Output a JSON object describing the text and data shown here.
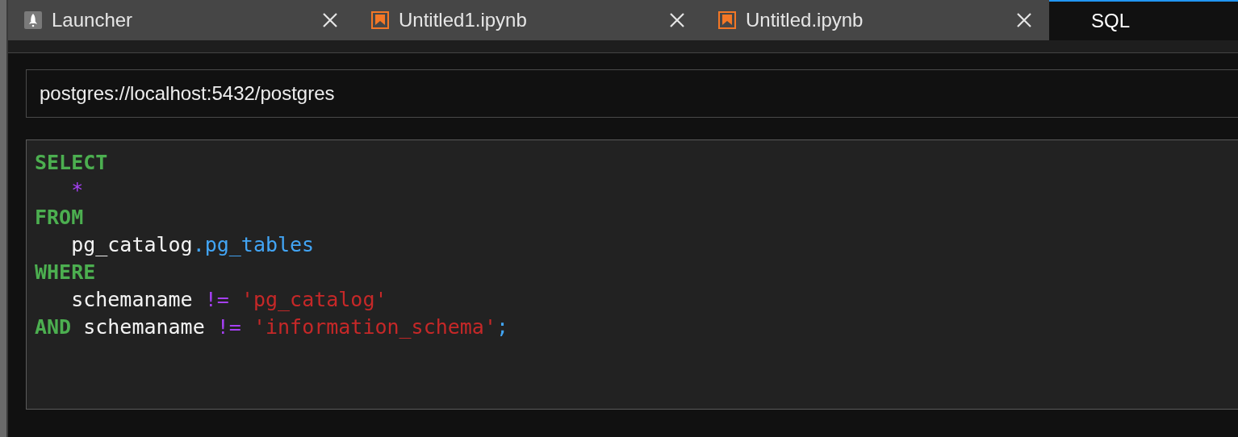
{
  "tabs": [
    {
      "label": "Launcher",
      "kind": "launcher",
      "selected": false,
      "closable": true
    },
    {
      "label": "Untitled1.ipynb",
      "kind": "notebook",
      "selected": false,
      "closable": true
    },
    {
      "label": "Untitled.ipynb",
      "kind": "notebook",
      "selected": false,
      "closable": true
    },
    {
      "label": "SQL",
      "kind": "plain",
      "selected": true,
      "closable": false
    }
  ],
  "connection": {
    "value": "postgres://localhost:5432/postgres"
  },
  "editor": {
    "lines": [
      {
        "indent": false,
        "tokens": [
          {
            "kind": "keyword",
            "text": "SELECT"
          }
        ]
      },
      {
        "indent": true,
        "tokens": [
          {
            "kind": "operator",
            "text": "*"
          }
        ]
      },
      {
        "indent": false,
        "tokens": [
          {
            "kind": "keyword",
            "text": "FROM"
          }
        ]
      },
      {
        "indent": true,
        "tokens": [
          {
            "kind": "plain",
            "text": "pg_catalog"
          },
          {
            "kind": "property",
            "text": ".pg_tables"
          }
        ]
      },
      {
        "indent": false,
        "tokens": [
          {
            "kind": "keyword",
            "text": "WHERE"
          }
        ]
      },
      {
        "indent": true,
        "tokens": [
          {
            "kind": "plain",
            "text": "schemaname "
          },
          {
            "kind": "operator",
            "text": "!= "
          },
          {
            "kind": "string",
            "text": "'pg_catalog'"
          }
        ]
      },
      {
        "indent": false,
        "tokens": [
          {
            "kind": "keyword",
            "text": "AND"
          },
          {
            "kind": "plain",
            "text": " schemaname "
          },
          {
            "kind": "operator",
            "text": "!= "
          },
          {
            "kind": "string",
            "text": "'information_schema'"
          },
          {
            "kind": "property",
            "text": ";"
          }
        ]
      }
    ]
  }
}
